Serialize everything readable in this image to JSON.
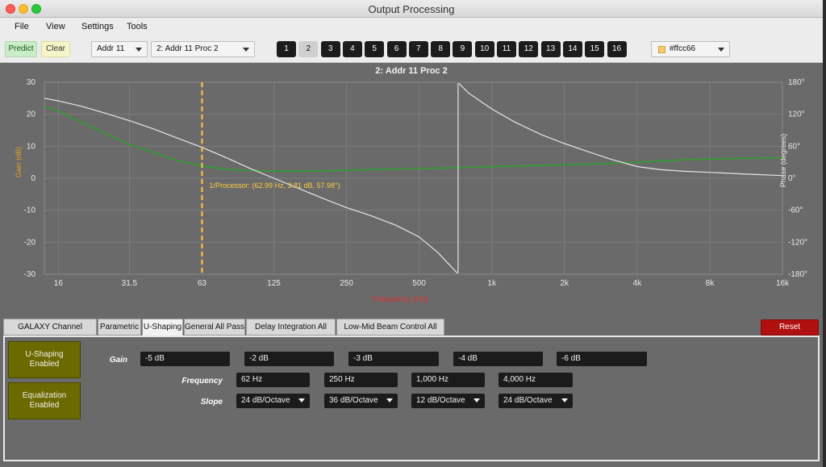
{
  "window": {
    "title": "Output Processing"
  },
  "menu": [
    "File",
    "View",
    "Settings",
    "Tools"
  ],
  "toolbar": {
    "predict_label": "Predict",
    "clear_label": "Clear",
    "address_select": "Addr 11",
    "processor_select": "2: Addr 11 Proc 2",
    "channel_buttons": [
      "1",
      "2",
      "3",
      "4",
      "5",
      "6",
      "7",
      "8",
      "9",
      "10",
      "11",
      "12",
      "13",
      "14",
      "15",
      "16"
    ],
    "active_channel": "2",
    "color_select": "#ffcc66"
  },
  "colors": {
    "gain_curve": "#2e9e2e",
    "phase_curve": "#e6e6e6",
    "cursor": "#ffcc44",
    "gain_axis_label": "#e8a020",
    "freq_axis_label": "#e03030"
  },
  "chart_data": {
    "type": "line",
    "title": "2: Addr 11 Proc 2",
    "xlabel": "Frequency (Hz)",
    "ylabel": "Gain (dB)",
    "y2label": "Phase (degrees)",
    "x_scale": "log",
    "xlim": [
      14,
      16000
    ],
    "ylim": [
      -30,
      30
    ],
    "y2lim": [
      -180,
      180
    ],
    "x_ticks": [
      16,
      31.5,
      63,
      125,
      250,
      500,
      1000,
      2000,
      4000,
      8000,
      16000
    ],
    "x_tick_labels": [
      "16",
      "31.5",
      "63",
      "125",
      "250",
      "500",
      "1k",
      "2k",
      "4k",
      "8k",
      "16k"
    ],
    "y_ticks": [
      30,
      20,
      10,
      0,
      -10,
      -20,
      -30
    ],
    "y2_ticks": [
      180,
      120,
      60,
      0,
      -60,
      -120,
      -180
    ],
    "y2_tick_labels": [
      "180°",
      "120°",
      "60°",
      "0°",
      "-60°",
      "-120°",
      "-180°"
    ],
    "grid": true,
    "cursor": {
      "x": 63,
      "label": "1/Processor: (62.99 Hz, 3.81 dB, 57.98°)"
    },
    "series": [
      {
        "axis": "left",
        "x": [
          14,
          16,
          20,
          25,
          31.5,
          40,
          50,
          63,
          80,
          100,
          125,
          160,
          200,
          250,
          315,
          400,
          500,
          630,
          800,
          1000,
          1250,
          1600,
          2000,
          2500,
          3150,
          4000,
          5000,
          6300,
          8000,
          10000,
          12500,
          16000
        ],
        "y": [
          22.5,
          21,
          17.5,
          14,
          10.5,
          8,
          5.5,
          3.8,
          2.8,
          2.4,
          2.2,
          2.2,
          2.3,
          2.5,
          2.7,
          2.9,
          3.0,
          3.2,
          3.4,
          3.6,
          3.8,
          4.0,
          4.2,
          4.4,
          4.7,
          5.0,
          5.4,
          5.8,
          6.0,
          6.2,
          6.3,
          6.4
        ]
      },
      {
        "axis": "right",
        "x": [
          14,
          16,
          20,
          25,
          31.5,
          40,
          50,
          63,
          80,
          100,
          125,
          160,
          200,
          250,
          315,
          400,
          500,
          600,
          720,
          730,
          800,
          1000,
          1250,
          1600,
          2000,
          2500,
          3150,
          4000,
          5000,
          6300,
          8000,
          10000,
          12500,
          16000
        ],
        "y": [
          150,
          145,
          135,
          122,
          108,
          92,
          75,
          58,
          38,
          18,
          0,
          -20,
          -38,
          -55,
          -70,
          -88,
          -110,
          -140,
          -178,
          178,
          160,
          130,
          105,
          82,
          65,
          50,
          35,
          22,
          16,
          13,
          11,
          9,
          7,
          5
        ]
      }
    ]
  },
  "tabs": [
    "GALAXY Channel Settings",
    "Parametric",
    "U-Shaping",
    "General All Pass",
    "Delay Integration All Pass",
    "Low-Mid Beam Control All Pass"
  ],
  "active_tab": "U-Shaping",
  "reset_label": "Reset",
  "ushaping": {
    "enabled_label": "U-Shaping Enabled",
    "eq_label": "Equalization Enabled",
    "gain_label": "Gain",
    "frequency_label": "Frequency",
    "slope_label": "Slope",
    "gains": [
      "-5 dB",
      "-2 dB",
      "-3 dB",
      "-4 dB",
      "-6 dB"
    ],
    "frequencies": [
      "62 Hz",
      "250 Hz",
      "1,000 Hz",
      "4,000 Hz"
    ],
    "slopes": [
      "24 dB/Octave",
      "36 dB/Octave",
      "12 dB/Octave",
      "24 dB/Octave"
    ]
  }
}
